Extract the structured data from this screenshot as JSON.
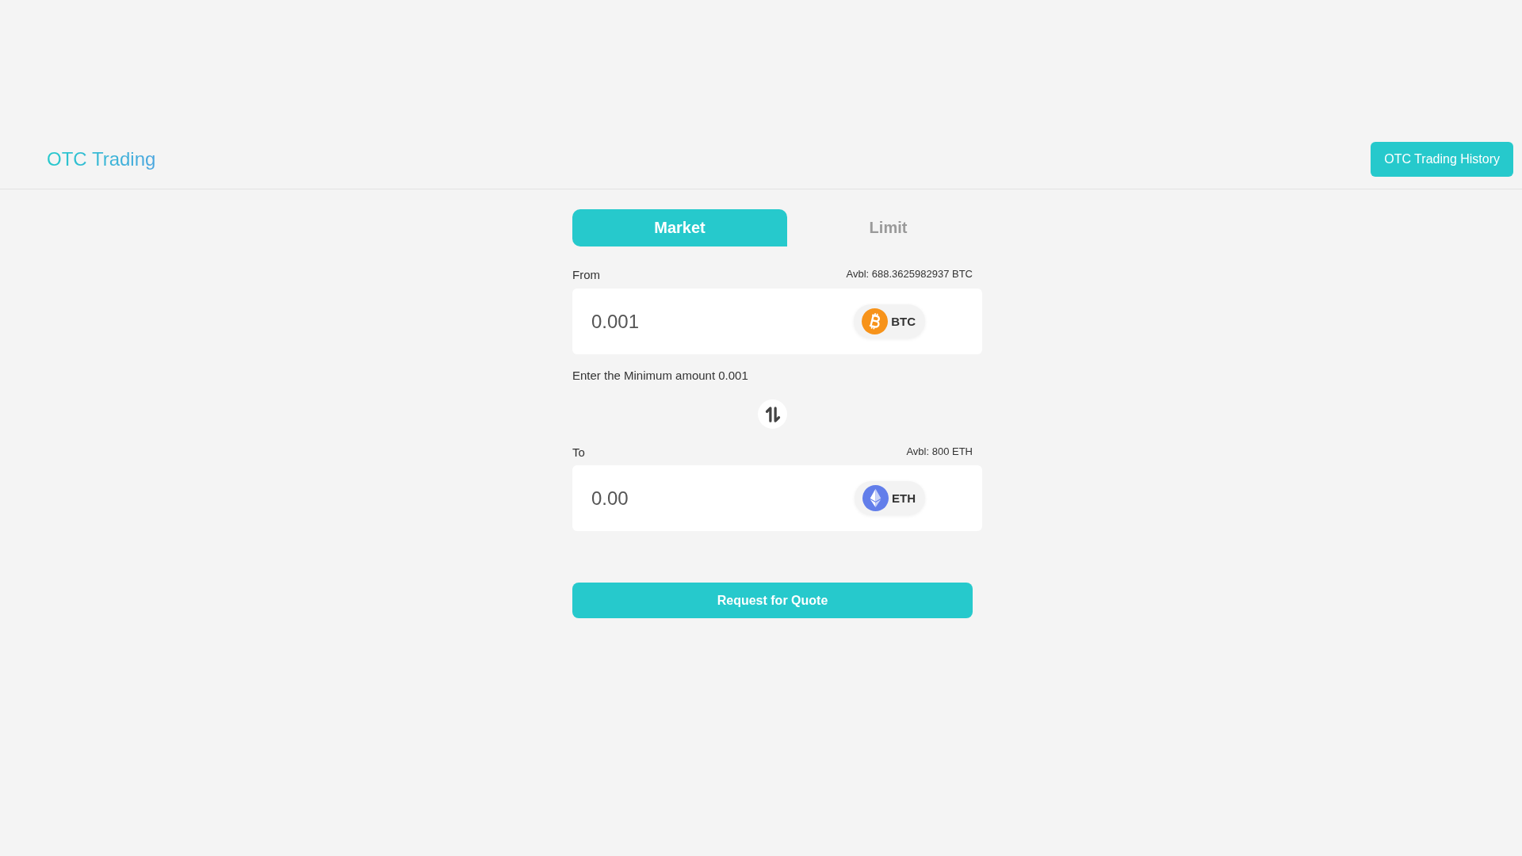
{
  "header": {
    "title": "OTC Trading",
    "history_button": "OTC Trading History"
  },
  "tabs": [
    {
      "label": "Market",
      "selected": true
    },
    {
      "label": "Limit",
      "selected": false
    }
  ],
  "from": {
    "label": "From",
    "available": "Avbl: 688.3625982937 BTC",
    "amount": "0.001",
    "currency": {
      "symbol": "BTC",
      "kind": "btc"
    }
  },
  "hint": "Enter the Minimum amount 0.001",
  "to": {
    "label": "To",
    "available": "Avbl: 800 ETH",
    "amount": "0.00",
    "currency": {
      "symbol": "ETH",
      "kind": "eth"
    }
  },
  "submit_button": "Request for Quote"
}
